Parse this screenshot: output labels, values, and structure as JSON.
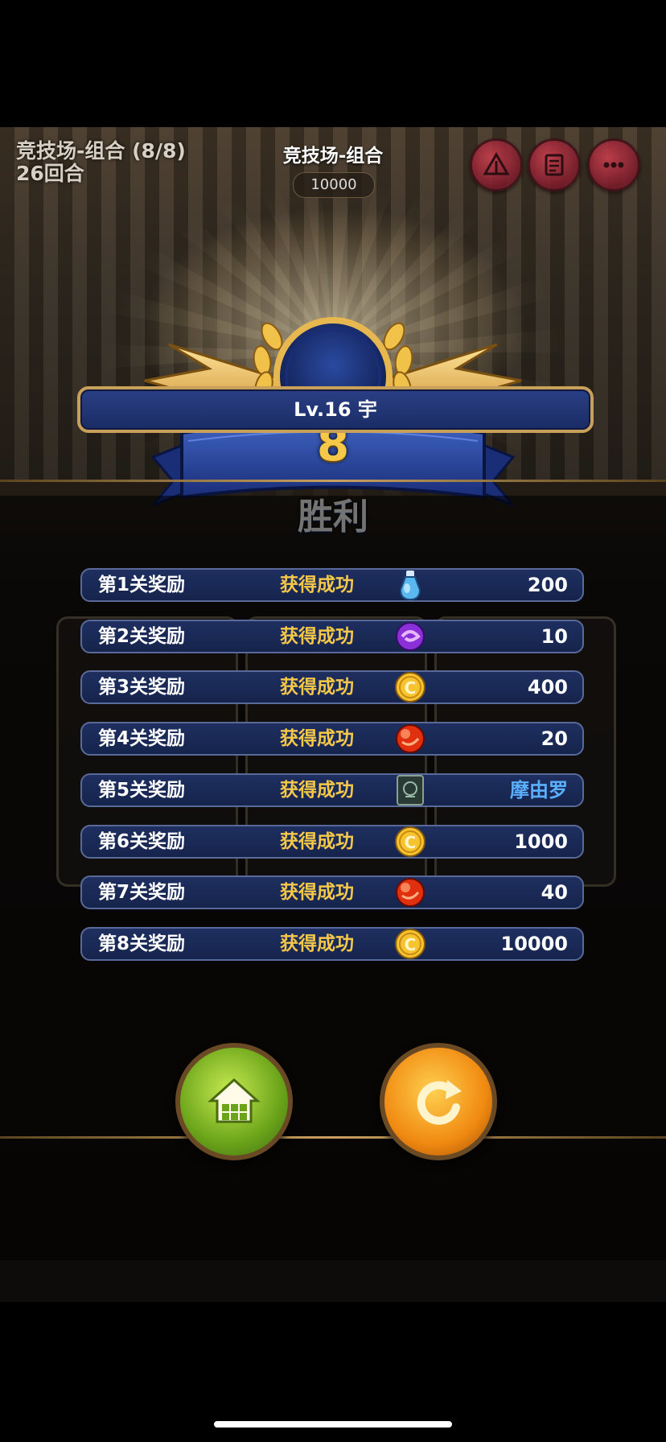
{
  "hud": {
    "mode_progress": "竞技场-组合 (8/8)",
    "rounds": "26回合",
    "title": "竞技场-组合",
    "score": "10000",
    "icons": [
      "stage-icon",
      "notes-icon",
      "more-icon"
    ]
  },
  "result": {
    "streak_number": "8",
    "label": "胜利"
  },
  "player": {
    "name": "Lv.16  宇"
  },
  "rewards": [
    {
      "stage": "第1关奖励",
      "status": "获得成功",
      "icon": "potion-icon",
      "amount": "200"
    },
    {
      "stage": "第2关奖励",
      "status": "获得成功",
      "icon": "purple-orb-icon",
      "amount": "10"
    },
    {
      "stage": "第3关奖励",
      "status": "获得成功",
      "icon": "gold-coin-icon",
      "amount": "400"
    },
    {
      "stage": "第4关奖励",
      "status": "获得成功",
      "icon": "red-orb-icon",
      "amount": "20"
    },
    {
      "stage": "第5关奖励",
      "status": "获得成功",
      "icon": "card-icon",
      "amount": "摩由罗"
    },
    {
      "stage": "第6关奖励",
      "status": "获得成功",
      "icon": "gold-coin-icon",
      "amount": "1000"
    },
    {
      "stage": "第7关奖励",
      "status": "获得成功",
      "icon": "red-orb-icon",
      "amount": "40"
    },
    {
      "stage": "第8关奖励",
      "status": "获得成功",
      "icon": "gold-coin-icon",
      "amount": "10000"
    }
  ],
  "colors": {
    "status_gold": "#f6c84a",
    "hero_blue": "#5ab0ff",
    "row_blue": "#1e2f60",
    "frame_gold": "#c8a05a"
  },
  "buttons": {
    "home": "home-icon",
    "retry": "retry-icon"
  }
}
